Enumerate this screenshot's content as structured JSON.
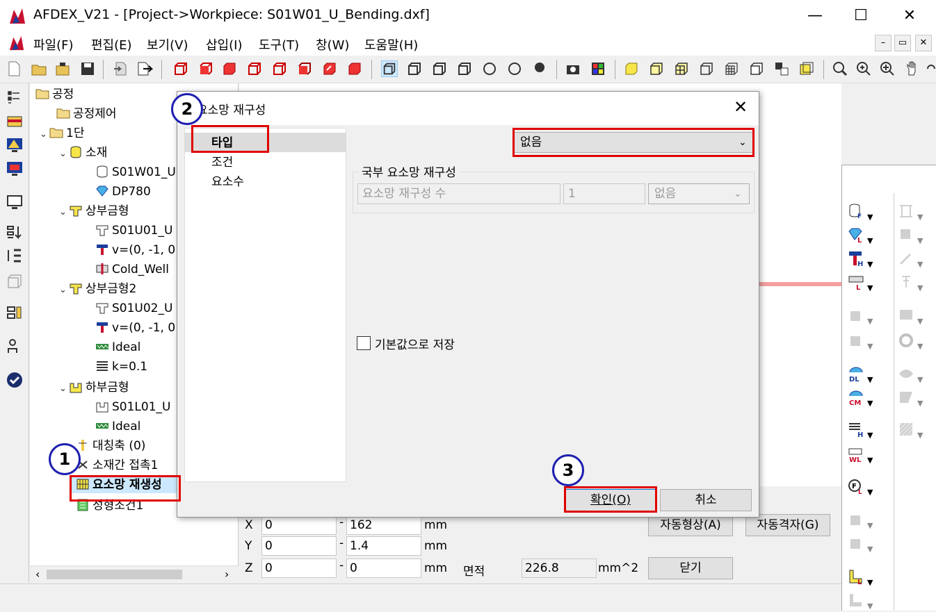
{
  "window": {
    "title": "AFDEX_V21 - [Project->Workpiece: S01W01_U_Bending.dxf]",
    "minimize": "—",
    "maximize": "☐",
    "close": "✕"
  },
  "menu": [
    "파일(F)",
    "편집(E)",
    "보기(V)",
    "삽입(I)",
    "도구(T)",
    "창(W)",
    "도움말(H)"
  ],
  "mdi": {
    "min": "–",
    "restore": "▭",
    "close": "✕"
  },
  "tree": {
    "root": "공정",
    "process_control": "공정제어",
    "stage1": "1단",
    "material": "소재",
    "material_file": "S01W01_U",
    "material_grade": "DP780",
    "upper_die": "상부금형",
    "upper_die_file": "S01U01_U",
    "upper_die_vel": "v=(0, -1, 0",
    "upper_die_cond": "Cold_Well",
    "upper_die2": "상부금형2",
    "upper_die2_file": "S01U02_U",
    "upper_die2_vel": "v=(0, -1, 0",
    "upper_die2_fric": "Ideal",
    "upper_die2_k": "k=0.1",
    "lower_die": "하부금형",
    "lower_die_file": "S01L01_U",
    "lower_die_fric": "Ideal",
    "symmetry": "대칭축 (0)",
    "contact": "소재간 접촉1",
    "remesh": "요소망 재생성",
    "forming": "성형조건1"
  },
  "dialog": {
    "title": "요소망 재구성",
    "close": "✕",
    "nav": [
      "타입",
      "조건",
      "요소수"
    ],
    "type_select": "없음",
    "group_title": "국부 요소망 재구성",
    "remesh_count_label": "요소망 재구성 수",
    "remesh_count_value": "1",
    "remesh_combo": "없음",
    "save_default": "기본값으로 저장",
    "ok": "확인(O)",
    "cancel": "취소"
  },
  "bottom": {
    "x_label": "X",
    "x_min": "0",
    "x_max": "162",
    "x_unit": "mm",
    "y_label": "Y",
    "y_min": "0",
    "y_max": "1.4",
    "y_unit": "mm",
    "z_label": "Z",
    "z_min": "0",
    "z_max": "0",
    "z_unit": "mm",
    "area_label": "면적",
    "area_value": "226.8",
    "area_unit": "mm^2",
    "auto_shape": "자동형상(A)",
    "auto_mesh": "자동격자(G)",
    "close_btn": "닫기"
  },
  "markers": {
    "m1": "1",
    "m2": "2",
    "m3": "3"
  },
  "colors": {
    "highlight": "#e00000",
    "marker": "#1f1fb0",
    "selection": "#cce8ff"
  }
}
